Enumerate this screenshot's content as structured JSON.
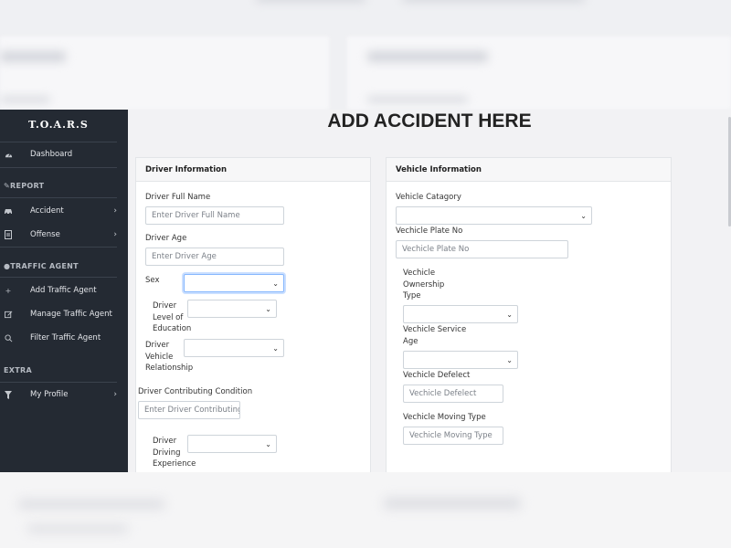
{
  "app": {
    "brand": "T.O.A.R.S",
    "page_title": "ADD ACCIDENT HERE"
  },
  "sidebar": {
    "dashboard": {
      "label": "Dashboard",
      "icon": "dashboard-gauge-icon"
    },
    "report_header": "REPORT",
    "accident": {
      "label": "Accident",
      "icon": "car-icon"
    },
    "offense": {
      "label": "Offense",
      "icon": "document-icon"
    },
    "traffic_agent_header": "TRAFFIC AGENT",
    "add_traffic_agent": {
      "label": "Add Traffic Agent",
      "icon": "plus-icon"
    },
    "manage_traffic_agent": {
      "label": "Manage Traffic Agent",
      "icon": "edit-icon"
    },
    "filter_traffic_agent": {
      "label": "Filter Traffic Agent",
      "icon": "search-icon"
    },
    "extra_header": "EXTRA",
    "my_profile": {
      "label": "My Profile",
      "icon": "filter-funnel-icon"
    }
  },
  "driver": {
    "title": "Driver Information",
    "full_name_label": "Driver Full Name",
    "full_name_placeholder": "Enter Driver Full Name",
    "age_label": "Driver Age",
    "age_placeholder": "Enter Driver Age",
    "sex_label": "Sex",
    "education_label_1": "Driver",
    "education_label_2": "Level of",
    "education_label_3": "Education",
    "relationship_label_1": "Driver",
    "relationship_label_2": "Vehicle",
    "relationship_label_3": "Relationship",
    "contributing_label": "Driver Contributing Condition",
    "contributing_placeholder": "Enter Driver Contributing Condition",
    "experience_label_1": "Driver",
    "experience_label_2": "Driving",
    "experience_label_3": "Experience"
  },
  "vehicle": {
    "title": "Vehicle Information",
    "category_label": "Vehicle Catagory",
    "plate_label": "Vechicle Plate No",
    "plate_placeholder": "Vechicle Plate No",
    "ownership_label_1": "Vechicle",
    "ownership_label_2": "Ownership",
    "ownership_label_3": "Type",
    "service_age_label_1": "Vechicle Service",
    "service_age_label_2": "Age",
    "defect_label": "Vechicle Defelect",
    "defect_placeholder": "Vechicle Defelect",
    "moving_type_label": "Vechicle Moving Type",
    "moving_type_placeholder": "Vechicle Moving Type"
  },
  "colors": {
    "sidebar_bg": "#242a33",
    "focus_ring": "#86b7fe"
  }
}
